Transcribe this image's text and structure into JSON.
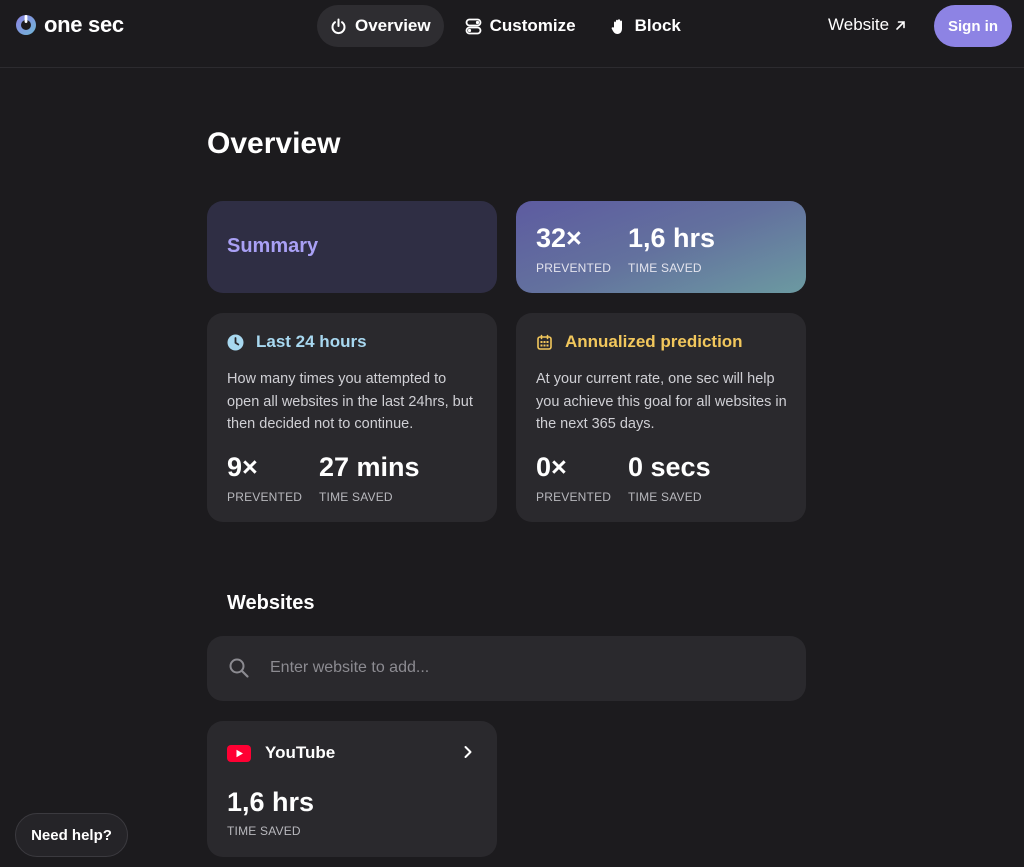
{
  "brand": {
    "name": "one sec"
  },
  "nav": {
    "items": [
      {
        "label": "Overview",
        "icon": "power-icon",
        "active": true
      },
      {
        "label": "Customize",
        "icon": "toggles-icon",
        "active": false
      },
      {
        "label": "Block",
        "icon": "hand-icon",
        "active": false
      }
    ],
    "website_label": "Website",
    "signin_label": "Sign in"
  },
  "page": {
    "title": "Overview"
  },
  "summary": {
    "title": "Summary",
    "prevented_value": "32×",
    "prevented_label": "PREVENTED",
    "saved_value": "1,6 hrs",
    "saved_label": "TIME SAVED"
  },
  "last24": {
    "title": "Last 24 hours",
    "description": "How many times you attempted to open all websites in the last 24hrs, but then decided not to continue.",
    "prevented_value": "9×",
    "prevented_label": "PREVENTED",
    "saved_value": "27 mins",
    "saved_label": "TIME SAVED"
  },
  "annual": {
    "title": "Annualized prediction",
    "description": "At your current rate, one sec will help you achieve this goal for all websites in the next 365 days.",
    "prevented_value": "0×",
    "prevented_label": "PREVENTED",
    "saved_value": "0 secs",
    "saved_label": "TIME SAVED"
  },
  "websites": {
    "title": "Websites",
    "search_placeholder": "Enter website to add...",
    "items": [
      {
        "name": "YouTube",
        "saved_value": "1,6 hrs",
        "saved_label": "TIME SAVED"
      }
    ]
  },
  "help": {
    "label": "Need help?"
  },
  "colors": {
    "background": "#1c1b1e",
    "card": "#2a292d",
    "accent": "#8d83e4",
    "summary_title": "#a9a0f5",
    "last24_title": "#a8d8f0",
    "annual_title": "#f2c75c",
    "youtube": "#ff0033"
  }
}
